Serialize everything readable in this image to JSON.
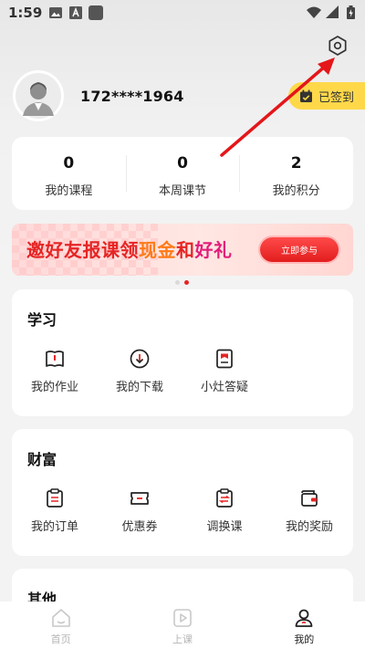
{
  "status_bar": {
    "time": "1:59"
  },
  "header": {
    "phone": "172****1964",
    "signin_label": "已签到",
    "accent_color": "#ffd84a"
  },
  "stats": [
    {
      "value": "0",
      "label": "我的课程"
    },
    {
      "value": "0",
      "label": "本周课节"
    },
    {
      "value": "2",
      "label": "我的积分"
    }
  ],
  "banner": {
    "title_part1": "邀好友报课领",
    "title_part2": "现金",
    "title_part3": "和",
    "title_part4": "好礼",
    "cta": "立即参与",
    "carousel_active_index": 1,
    "carousel_count": 2
  },
  "study": {
    "title": "学习",
    "items": [
      {
        "label": "我的作业",
        "icon": "homework-icon"
      },
      {
        "label": "我的下载",
        "icon": "download-icon"
      },
      {
        "label": "小灶答疑",
        "icon": "qa-icon"
      }
    ]
  },
  "wealth": {
    "title": "财富",
    "items": [
      {
        "label": "我的订单",
        "icon": "order-icon"
      },
      {
        "label": "优惠券",
        "icon": "coupon-icon"
      },
      {
        "label": "调换课",
        "icon": "swap-course-icon"
      },
      {
        "label": "我的奖励",
        "icon": "reward-icon"
      }
    ]
  },
  "other": {
    "title": "其他"
  },
  "tabs": [
    {
      "label": "首页",
      "icon": "home-icon",
      "active": false
    },
    {
      "label": "上课",
      "icon": "play-icon",
      "active": false
    },
    {
      "label": "我的",
      "icon": "profile-icon",
      "active": true
    }
  ],
  "colors": {
    "brand_red": "#e62424",
    "background": "#f3f3f3"
  }
}
